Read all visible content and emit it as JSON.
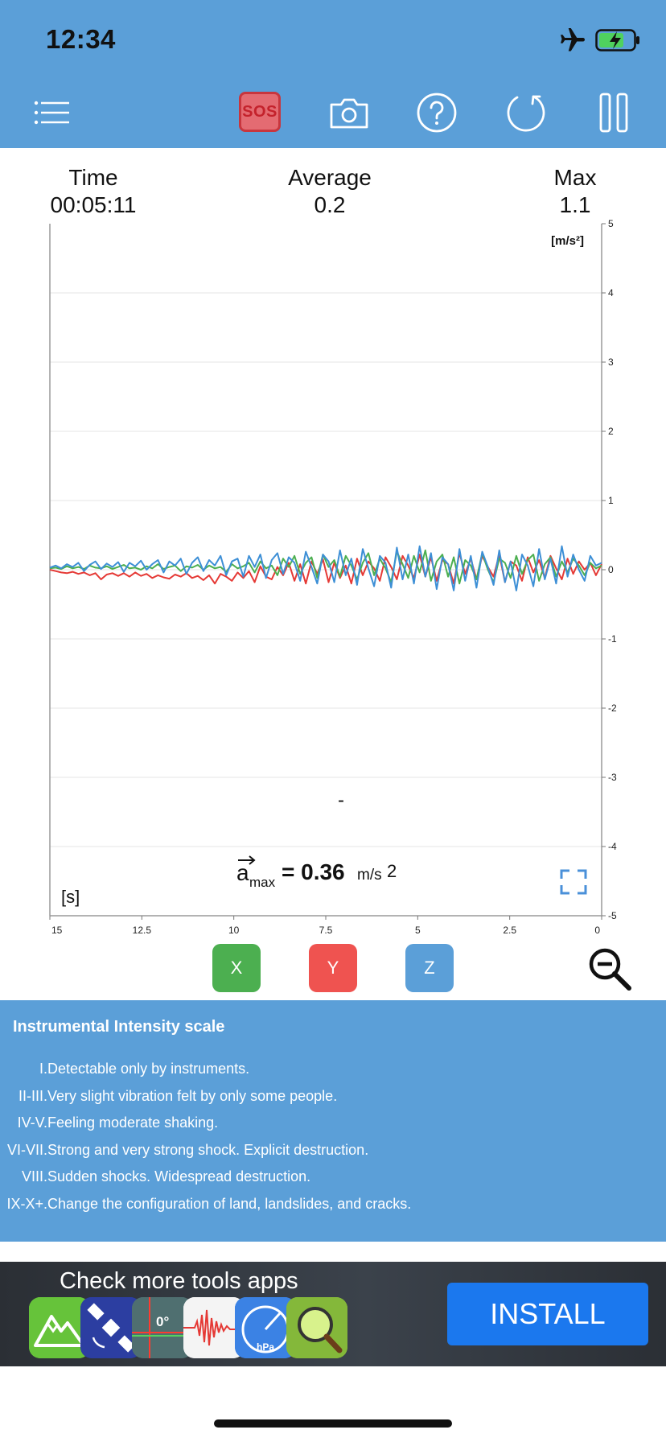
{
  "status_bar": {
    "time": "12:34"
  },
  "toolbar": {
    "sos_label": "SOS"
  },
  "stats": {
    "time_label": "Time",
    "time_value": "00:05:11",
    "average_label": "Average",
    "average_value": "0.2",
    "max_label": "Max",
    "max_value": "1.1"
  },
  "chart_data": {
    "type": "line",
    "unit": "[m/s²]",
    "x_unit": "[s]",
    "xlim": [
      15,
      0
    ],
    "ylim": [
      -5,
      5
    ],
    "x_ticks": [
      "15",
      "12.5",
      "10",
      "7.5",
      "5",
      "2.5",
      "0"
    ],
    "y_ticks": [
      "5",
      "4",
      "3",
      "2",
      "1",
      "0",
      "-1",
      "-2",
      "-3",
      "-4",
      "-5"
    ],
    "annotation_prefix": "a",
    "annotation_sub": "max",
    "annotation_eq": "= 0.36",
    "annotation_unit": "m/s",
    "annotation_exp": "2",
    "marker_text": "-",
    "grid": true,
    "series": [
      {
        "color": "#e53935",
        "values": [
          0.0,
          -0.02,
          -0.04,
          -0.05,
          -0.03,
          -0.06,
          -0.04,
          -0.08,
          -0.05,
          -0.14,
          -0.07,
          -0.05,
          -0.09,
          -0.05,
          -0.1,
          -0.04,
          -0.09,
          -0.06,
          -0.12,
          -0.08,
          -0.11,
          -0.13,
          -0.07,
          -0.1,
          -0.05,
          -0.12,
          -0.09,
          -0.15,
          -0.08,
          -0.2,
          -0.06,
          -0.1,
          -0.16,
          -0.04,
          -0.12,
          -0.02,
          -0.18,
          0.05,
          -0.1,
          -0.14,
          0.04,
          -0.08,
          0.1,
          -0.16,
          0.08,
          -0.2,
          0.12,
          -0.06,
          0.15,
          -0.18,
          0.1,
          -0.12,
          0.06,
          -0.2,
          0.16,
          -0.08,
          0.12,
          0.02,
          -0.16,
          0.18,
          0.04,
          -0.14,
          0.2,
          0.06,
          -0.12,
          0.22,
          -0.1,
          0.18,
          -0.16,
          0.14,
          0.08,
          -0.2,
          0.24,
          -0.06,
          0.16,
          -0.14,
          0.2,
          0.04,
          -0.1,
          0.22,
          -0.18,
          0.12,
          0.06,
          -0.16,
          0.18,
          -0.04,
          0.14,
          -0.12,
          0.2,
          0.02,
          -0.14,
          0.16,
          -0.06,
          0.12,
          0.0,
          0.1,
          -0.08,
          0.08
        ]
      },
      {
        "color": "#4caf50",
        "values": [
          0.02,
          0.03,
          0.01,
          0.05,
          0.02,
          0.04,
          0.01,
          0.06,
          0.03,
          0.02,
          0.05,
          0.01,
          0.04,
          0.07,
          0.02,
          0.03,
          0.0,
          0.05,
          0.02,
          0.08,
          0.01,
          0.04,
          0.06,
          -0.02,
          0.05,
          0.03,
          0.07,
          0.0,
          0.06,
          0.02,
          0.04,
          -0.03,
          0.08,
          0.02,
          0.05,
          0.1,
          -0.04,
          0.12,
          0.02,
          0.06,
          -0.08,
          0.16,
          0.04,
          0.2,
          -0.06,
          0.1,
          0.18,
          -0.12,
          0.22,
          0.04,
          0.14,
          -0.1,
          0.2,
          0.06,
          -0.14,
          0.1,
          0.24,
          -0.08,
          0.16,
          0.02,
          -0.18,
          0.26,
          0.08,
          -0.12,
          0.2,
          -0.04,
          0.28,
          -0.16,
          0.12,
          0.22,
          -0.1,
          0.18,
          -0.2,
          0.14,
          0.06,
          -0.14,
          0.24,
          0.0,
          -0.18,
          0.16,
          0.1,
          -0.12,
          0.2,
          -0.06,
          0.14,
          0.22,
          -0.16,
          0.08,
          0.18,
          -0.1,
          0.12,
          -0.04,
          0.16,
          0.06,
          -0.08,
          0.1,
          0.02,
          0.06
        ]
      },
      {
        "color": "#3d8fd6",
        "values": [
          0.03,
          0.06,
          0.02,
          0.08,
          0.04,
          0.1,
          -0.02,
          0.07,
          0.12,
          0.01,
          0.09,
          0.04,
          0.11,
          -0.03,
          0.1,
          0.05,
          0.13,
          0.0,
          0.08,
          0.14,
          -0.04,
          0.12,
          0.06,
          0.16,
          -0.06,
          0.1,
          0.18,
          -0.02,
          0.14,
          0.06,
          0.2,
          -0.08,
          0.12,
          0.16,
          -0.1,
          0.2,
          0.04,
          0.22,
          -0.12,
          0.14,
          0.24,
          -0.06,
          0.18,
          0.1,
          -0.16,
          0.26,
          0.04,
          -0.2,
          0.22,
          0.12,
          -0.18,
          0.28,
          -0.08,
          0.16,
          -0.22,
          0.3,
          0.02,
          -0.24,
          0.2,
          0.1,
          -0.26,
          0.32,
          -0.14,
          0.22,
          -0.2,
          0.34,
          -0.1,
          0.24,
          -0.28,
          0.18,
          0.08,
          -0.3,
          0.3,
          -0.16,
          0.2,
          -0.26,
          0.26,
          0.04,
          -0.22,
          0.28,
          -0.18,
          0.12,
          -0.3,
          0.22,
          0.06,
          -0.24,
          0.3,
          -0.14,
          0.16,
          -0.2,
          0.34,
          -0.1,
          0.22,
          0.0,
          -0.16,
          0.2,
          0.06,
          0.1
        ]
      }
    ]
  },
  "axis_buttons": {
    "x": "X",
    "y": "Y",
    "z": "Z"
  },
  "intensity": {
    "title": "Instrumental Intensity scale",
    "items": [
      {
        "level": "I.",
        "text": "Detectable only by instruments."
      },
      {
        "level": "II-III.",
        "text": "Very slight vibration felt by only some people."
      },
      {
        "level": "IV-V.",
        "text": "Feeling moderate shaking."
      },
      {
        "level": "VI-VII.",
        "text": "Strong and very strong shock. Explicit destruction."
      },
      {
        "level": "VIII.",
        "text": "Sudden shocks. Widespread destruction."
      },
      {
        "level": "IX-X+.",
        "text": "Change the configuration of land, landslides, and cracks."
      }
    ]
  },
  "ad": {
    "title": "Check more tools apps",
    "install_label": "INSTALL",
    "compass_label": "0°",
    "hpa_label": "hPa",
    "icons": [
      "mountain-app-icon",
      "satellite-app-icon",
      "compass-app-icon",
      "seismometer-app-icon",
      "barometer-app-icon",
      "magnifier-app-icon"
    ]
  },
  "colors": {
    "accent": "#5b9fd8",
    "x": "#4caf50",
    "y": "#ef5350",
    "z": "#5b9fd8",
    "install": "#1b78ee"
  }
}
